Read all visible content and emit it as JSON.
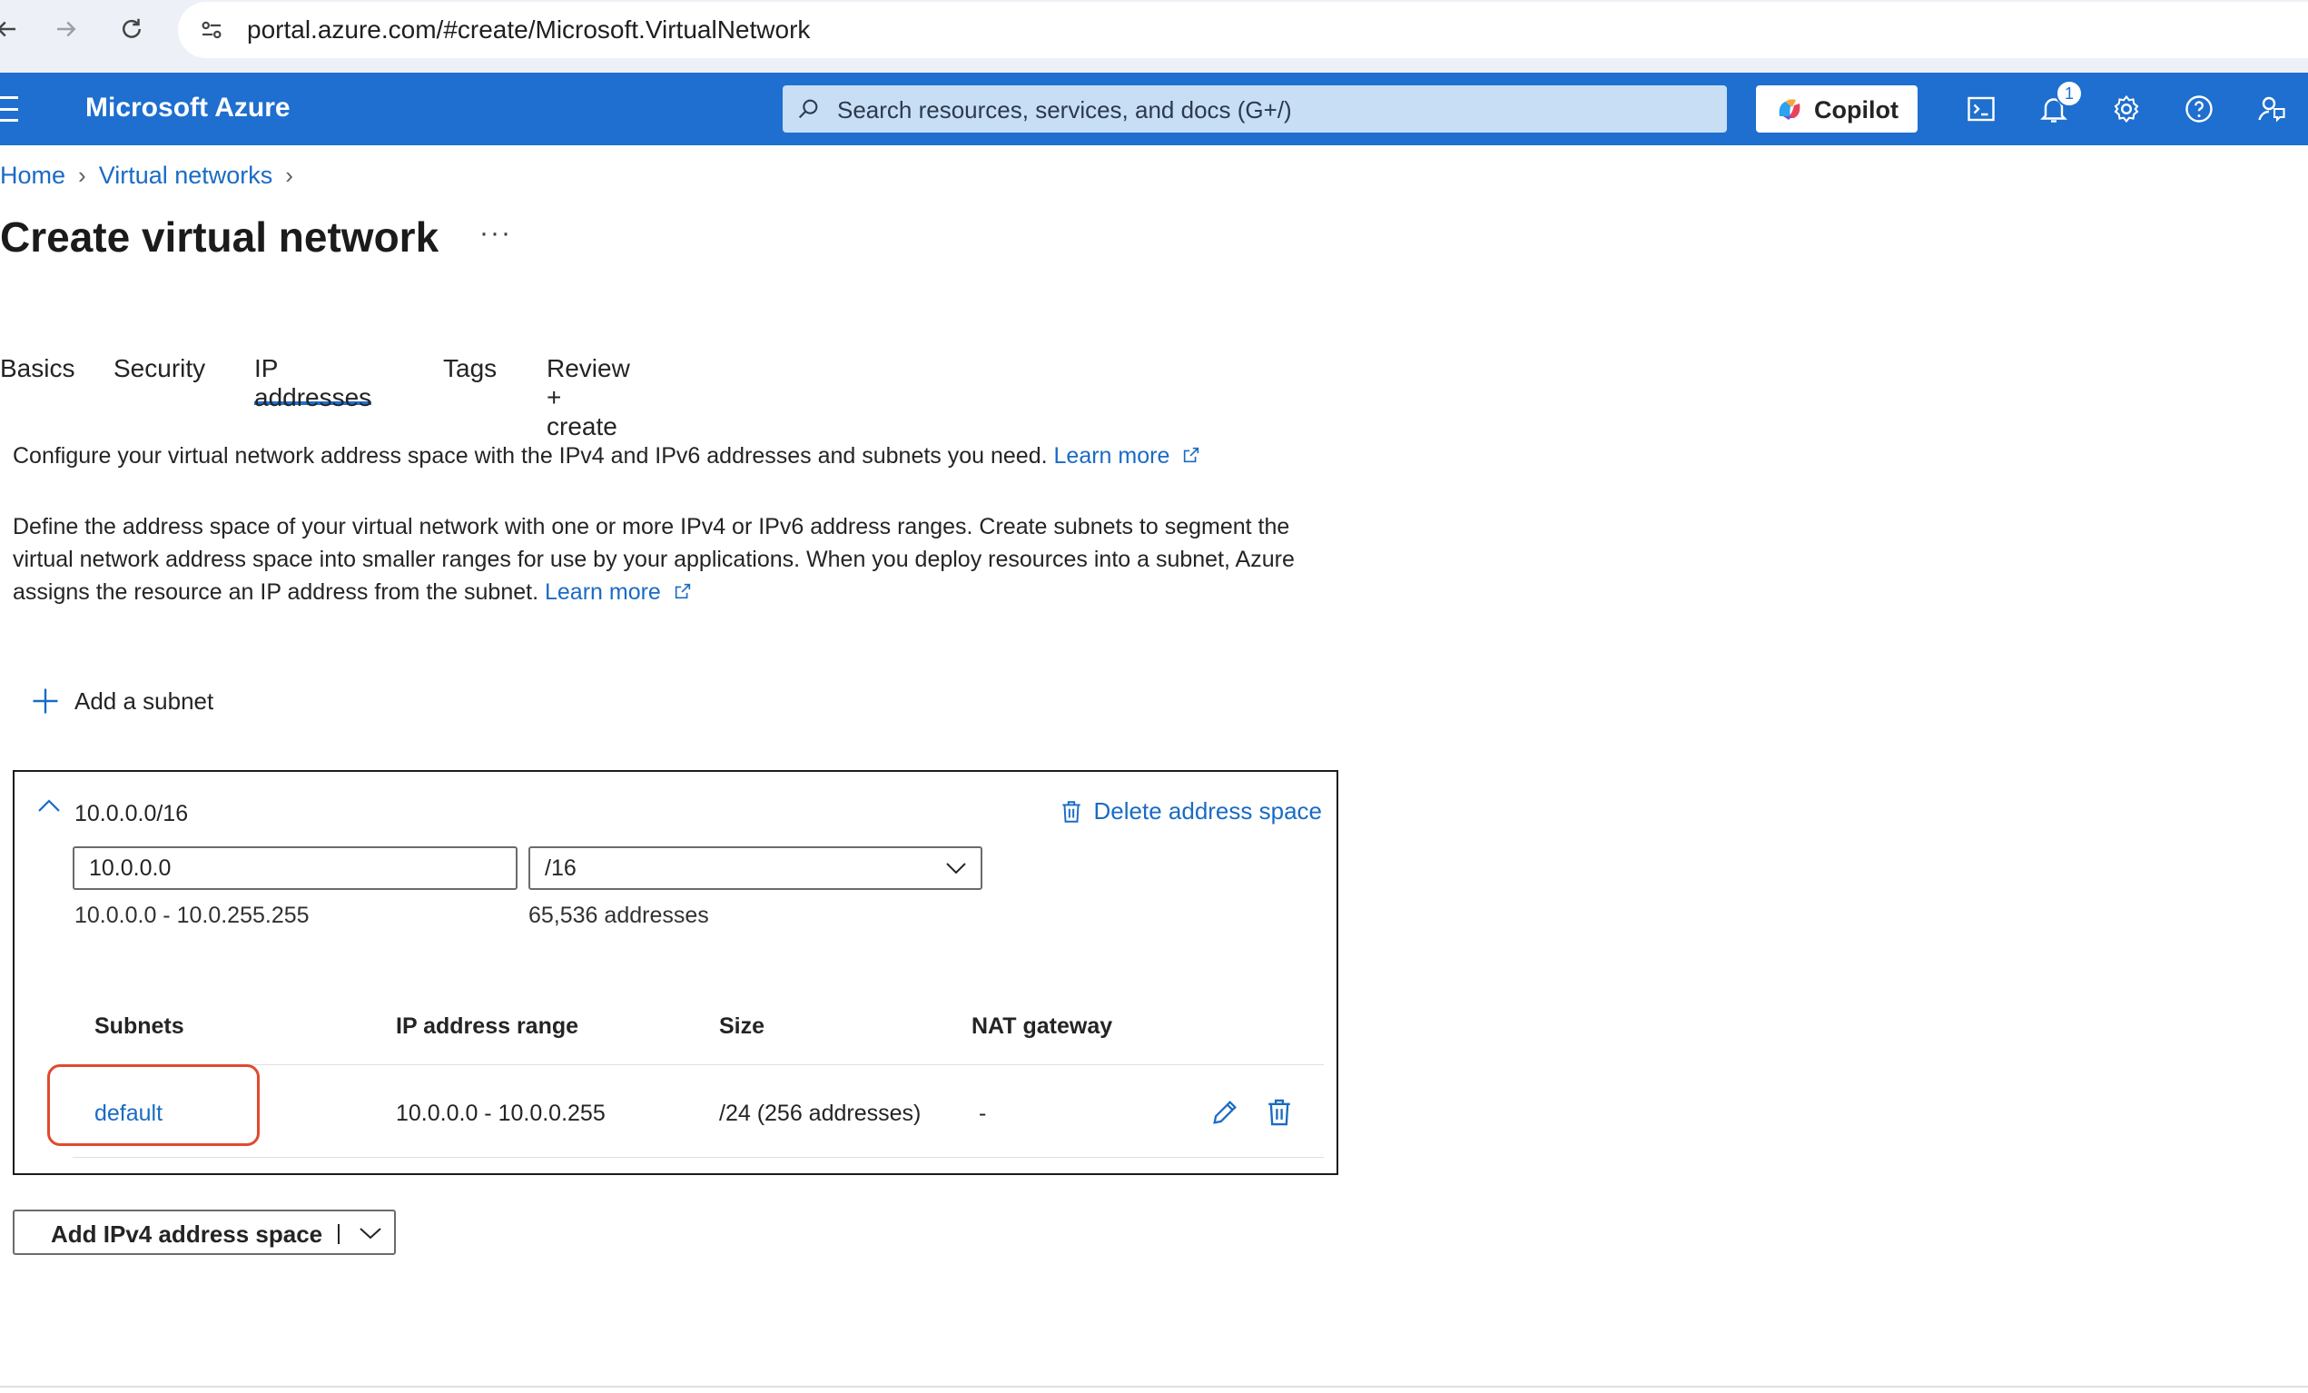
{
  "browser": {
    "url": "portal.azure.com/#create/Microsoft.VirtualNetwork"
  },
  "header": {
    "brand": "Microsoft Azure",
    "search_placeholder": "Search resources, services, and docs (G+/)",
    "copilot_label": "Copilot",
    "notification_count": "1"
  },
  "breadcrumb": [
    "Home",
    "Virtual networks"
  ],
  "page": {
    "title": "Create virtual network",
    "more": "···"
  },
  "tabs": [
    "Basics",
    "Security",
    "IP addresses",
    "Tags",
    "Review + create"
  ],
  "active_tab": "IP addresses",
  "intro": {
    "line1": "Configure your virtual network address space with the IPv4 and IPv6 addresses and subnets you need.",
    "line2": "Define the address space of your virtual network with one or more IPv4 or IPv6 address ranges. Create subnets to segment the virtual network address space into smaller ranges for use by your applications. When you deploy resources into a subnet, Azure assigns the resource an IP address from the subnet.",
    "learn_more": "Learn more"
  },
  "add_subnet_label": "Add a subnet",
  "address_space": {
    "title": "10.0.0.0/16",
    "delete_label": "Delete address space",
    "ip_value": "10.0.0.0",
    "cidr_value": "/16",
    "range": "10.0.0.0 - 10.0.255.255",
    "count": "65,536 addresses",
    "columns": [
      "Subnets",
      "IP address range",
      "Size",
      "NAT gateway"
    ],
    "rows": [
      {
        "name": "default",
        "range": "10.0.0.0 - 10.0.0.255",
        "size": "/24 (256 addresses)",
        "nat": "-"
      }
    ]
  },
  "add_space_button": "Add IPv4 address space",
  "colors": {
    "azure_blue": "#1e6fcf",
    "link": "#1a6bc4",
    "highlight": "#e04a2e"
  }
}
